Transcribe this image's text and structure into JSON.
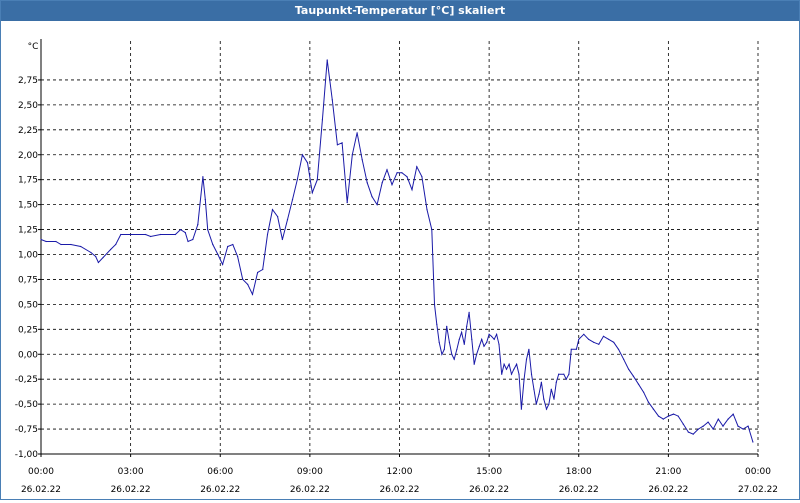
{
  "window": {
    "title": "Taupunkt-Temperatur [°C] skaliert"
  },
  "chart_data": {
    "type": "line",
    "title": "Taupunkt-Temperatur [°C] skaliert",
    "ylabel": "°C",
    "xlabel": "",
    "ylim": [
      -1.0,
      3.0
    ],
    "xlim_hours": [
      0,
      24
    ],
    "grid": true,
    "legend": "none",
    "colors": {
      "line": "#1a1aa8",
      "grid": "#000000",
      "title_bg": "#3a6ea5"
    },
    "y_ticks": [
      {
        "v": 2.75,
        "label": "2,75"
      },
      {
        "v": 2.5,
        "label": "2,50"
      },
      {
        "v": 2.25,
        "label": "2,25"
      },
      {
        "v": 2.0,
        "label": "2,00"
      },
      {
        "v": 1.75,
        "label": "1,75"
      },
      {
        "v": 1.5,
        "label": "1,50"
      },
      {
        "v": 1.25,
        "label": "1,25"
      },
      {
        "v": 1.0,
        "label": "1,00"
      },
      {
        "v": 0.75,
        "label": "0,75"
      },
      {
        "v": 0.5,
        "label": "0,50"
      },
      {
        "v": 0.25,
        "label": "0,25"
      },
      {
        "v": 0.0,
        "label": "0,00"
      },
      {
        "v": -0.25,
        "label": "-0,25"
      },
      {
        "v": -0.5,
        "label": "-0,50"
      },
      {
        "v": -0.75,
        "label": "-0,75"
      },
      {
        "v": -1.0,
        "label": "-1,00"
      }
    ],
    "x_ticks": [
      {
        "h": 0,
        "time": "00:00",
        "date": "26.02.22"
      },
      {
        "h": 3,
        "time": "03:00",
        "date": "26.02.22"
      },
      {
        "h": 6,
        "time": "06:00",
        "date": "26.02.22"
      },
      {
        "h": 9,
        "time": "09:00",
        "date": "26.02.22"
      },
      {
        "h": 12,
        "time": "12:00",
        "date": "26.02.22"
      },
      {
        "h": 15,
        "time": "15:00",
        "date": "26.02.22"
      },
      {
        "h": 18,
        "time": "18:00",
        "date": "26.02.22"
      },
      {
        "h": 21,
        "time": "21:00",
        "date": "26.02.22"
      },
      {
        "h": 24,
        "time": "00:00",
        "date": "27.02.22"
      }
    ],
    "series": [
      {
        "values": [
          [
            0.0,
            1.15
          ],
          [
            0.17,
            1.13
          ],
          [
            0.5,
            1.13
          ],
          [
            0.67,
            1.1
          ],
          [
            1.0,
            1.1
          ],
          [
            1.33,
            1.08
          ],
          [
            1.67,
            1.02
          ],
          [
            1.83,
            0.98
          ],
          [
            1.92,
            0.92
          ],
          [
            2.08,
            0.97
          ],
          [
            2.33,
            1.05
          ],
          [
            2.5,
            1.1
          ],
          [
            2.67,
            1.2
          ],
          [
            3.0,
            1.2
          ],
          [
            3.5,
            1.2
          ],
          [
            3.67,
            1.18
          ],
          [
            4.0,
            1.2
          ],
          [
            4.5,
            1.2
          ],
          [
            4.67,
            1.25
          ],
          [
            4.83,
            1.22
          ],
          [
            4.92,
            1.13
          ],
          [
            5.08,
            1.15
          ],
          [
            5.25,
            1.3
          ],
          [
            5.42,
            1.78
          ],
          [
            5.5,
            1.55
          ],
          [
            5.58,
            1.25
          ],
          [
            5.75,
            1.1
          ],
          [
            5.92,
            1.0
          ],
          [
            6.08,
            0.9
          ],
          [
            6.25,
            1.08
          ],
          [
            6.42,
            1.1
          ],
          [
            6.58,
            0.98
          ],
          [
            6.75,
            0.75
          ],
          [
            6.92,
            0.7
          ],
          [
            7.08,
            0.6
          ],
          [
            7.25,
            0.82
          ],
          [
            7.42,
            0.85
          ],
          [
            7.58,
            1.2
          ],
          [
            7.75,
            1.45
          ],
          [
            7.92,
            1.38
          ],
          [
            8.08,
            1.15
          ],
          [
            8.25,
            1.35
          ],
          [
            8.42,
            1.55
          ],
          [
            8.58,
            1.75
          ],
          [
            8.75,
            2.0
          ],
          [
            8.92,
            1.92
          ],
          [
            9.08,
            1.62
          ],
          [
            9.25,
            1.75
          ],
          [
            9.42,
            2.35
          ],
          [
            9.58,
            2.95
          ],
          [
            9.75,
            2.55
          ],
          [
            9.92,
            2.1
          ],
          [
            10.08,
            2.12
          ],
          [
            10.25,
            1.52
          ],
          [
            10.42,
            2.0
          ],
          [
            10.58,
            2.22
          ],
          [
            10.75,
            1.95
          ],
          [
            10.92,
            1.72
          ],
          [
            11.08,
            1.58
          ],
          [
            11.25,
            1.5
          ],
          [
            11.42,
            1.72
          ],
          [
            11.58,
            1.85
          ],
          [
            11.75,
            1.7
          ],
          [
            11.92,
            1.82
          ],
          [
            12.08,
            1.82
          ],
          [
            12.25,
            1.78
          ],
          [
            12.42,
            1.65
          ],
          [
            12.58,
            1.88
          ],
          [
            12.75,
            1.78
          ],
          [
            12.92,
            1.45
          ],
          [
            13.08,
            1.25
          ],
          [
            13.17,
            0.5
          ],
          [
            13.25,
            0.3
          ],
          [
            13.33,
            0.12
          ],
          [
            13.42,
            0.0
          ],
          [
            13.5,
            0.05
          ],
          [
            13.58,
            0.28
          ],
          [
            13.67,
            0.12
          ],
          [
            13.75,
            0.0
          ],
          [
            13.83,
            -0.05
          ],
          [
            13.92,
            0.05
          ],
          [
            14.0,
            0.15
          ],
          [
            14.08,
            0.22
          ],
          [
            14.17,
            0.1
          ],
          [
            14.25,
            0.28
          ],
          [
            14.33,
            0.42
          ],
          [
            14.42,
            0.15
          ],
          [
            14.5,
            -0.1
          ],
          [
            14.58,
            0.0
          ],
          [
            14.67,
            0.08
          ],
          [
            14.75,
            0.15
          ],
          [
            14.83,
            0.08
          ],
          [
            14.92,
            0.12
          ],
          [
            15.0,
            0.2
          ],
          [
            15.08,
            0.18
          ],
          [
            15.17,
            0.15
          ],
          [
            15.25,
            0.2
          ],
          [
            15.33,
            0.1
          ],
          [
            15.42,
            -0.2
          ],
          [
            15.5,
            -0.1
          ],
          [
            15.58,
            -0.15
          ],
          [
            15.67,
            -0.1
          ],
          [
            15.75,
            -0.2
          ],
          [
            15.83,
            -0.15
          ],
          [
            15.92,
            -0.1
          ],
          [
            16.0,
            -0.2
          ],
          [
            16.08,
            -0.55
          ],
          [
            16.17,
            -0.25
          ],
          [
            16.25,
            -0.05
          ],
          [
            16.33,
            0.05
          ],
          [
            16.42,
            -0.2
          ],
          [
            16.5,
            -0.35
          ],
          [
            16.58,
            -0.5
          ],
          [
            16.67,
            -0.4
          ],
          [
            16.75,
            -0.28
          ],
          [
            16.83,
            -0.45
          ],
          [
            16.92,
            -0.55
          ],
          [
            17.0,
            -0.5
          ],
          [
            17.08,
            -0.35
          ],
          [
            17.17,
            -0.45
          ],
          [
            17.25,
            -0.28
          ],
          [
            17.33,
            -0.2
          ],
          [
            17.5,
            -0.2
          ],
          [
            17.58,
            -0.25
          ],
          [
            17.67,
            -0.2
          ],
          [
            17.75,
            0.05
          ],
          [
            17.92,
            0.05
          ],
          [
            18.0,
            0.15
          ],
          [
            18.17,
            0.2
          ],
          [
            18.33,
            0.15
          ],
          [
            18.5,
            0.12
          ],
          [
            18.67,
            0.1
          ],
          [
            18.83,
            0.18
          ],
          [
            19.0,
            0.15
          ],
          [
            19.17,
            0.12
          ],
          [
            19.33,
            0.05
          ],
          [
            19.5,
            -0.05
          ],
          [
            19.67,
            -0.15
          ],
          [
            19.83,
            -0.22
          ],
          [
            20.0,
            -0.3
          ],
          [
            20.17,
            -0.38
          ],
          [
            20.33,
            -0.48
          ],
          [
            20.5,
            -0.55
          ],
          [
            20.67,
            -0.62
          ],
          [
            20.83,
            -0.65
          ],
          [
            21.0,
            -0.62
          ],
          [
            21.17,
            -0.6
          ],
          [
            21.33,
            -0.62
          ],
          [
            21.5,
            -0.7
          ],
          [
            21.67,
            -0.78
          ],
          [
            21.83,
            -0.8
          ],
          [
            22.0,
            -0.75
          ],
          [
            22.17,
            -0.72
          ],
          [
            22.33,
            -0.68
          ],
          [
            22.5,
            -0.75
          ],
          [
            22.67,
            -0.65
          ],
          [
            22.83,
            -0.72
          ],
          [
            23.0,
            -0.65
          ],
          [
            23.17,
            -0.6
          ],
          [
            23.33,
            -0.72
          ],
          [
            23.5,
            -0.75
          ],
          [
            23.67,
            -0.72
          ],
          [
            23.83,
            -0.88
          ]
        ]
      }
    ]
  }
}
